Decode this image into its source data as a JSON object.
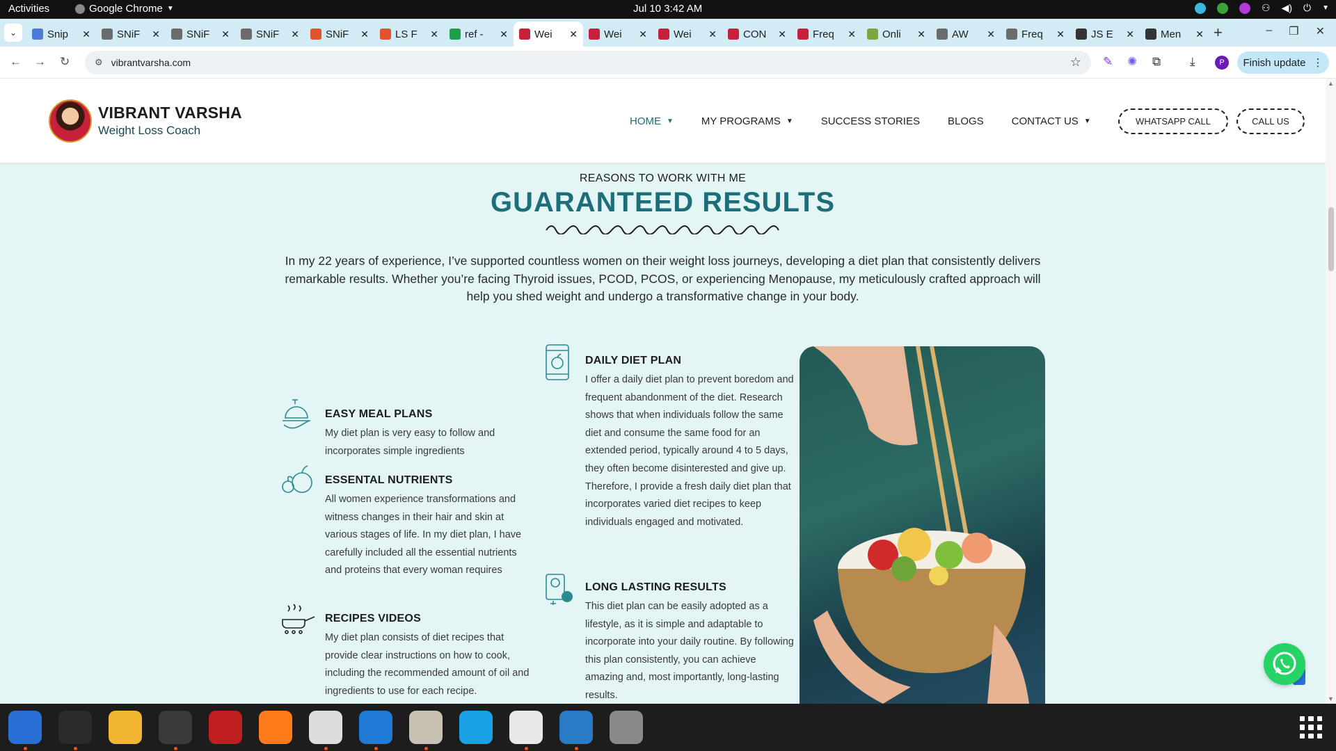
{
  "system": {
    "activities": "Activities",
    "app_name": "Google Chrome",
    "clock": "Jul 10  3:42 AM"
  },
  "browser": {
    "tabs": [
      {
        "label": "Snip",
        "color": "#4a7bd8"
      },
      {
        "label": "SNiF",
        "color": "#6b6b6b"
      },
      {
        "label": "SNiF",
        "color": "#6b6b6b"
      },
      {
        "label": "SNiF",
        "color": "#6b6b6b"
      },
      {
        "label": "SNiF",
        "color": "#e0542c"
      },
      {
        "label": "LS F",
        "color": "#e0542c"
      },
      {
        "label": "ref -",
        "color": "#1e9e4a"
      },
      {
        "label": "Wei",
        "color": "#c6203b"
      },
      {
        "label": "Wei",
        "color": "#c6203b"
      },
      {
        "label": "Wei",
        "color": "#c6203b"
      },
      {
        "label": "CON",
        "color": "#c6203b"
      },
      {
        "label": "Freq",
        "color": "#c6203b"
      },
      {
        "label": "Onli",
        "color": "#7aa83c"
      },
      {
        "label": "AW",
        "color": "#6b6b6b"
      },
      {
        "label": "Freq",
        "color": "#6b6b6b"
      },
      {
        "label": "JS E",
        "color": "#333333"
      },
      {
        "label": "Men",
        "color": "#333333"
      }
    ],
    "active_tab_index": 7,
    "url": "vibrantvarsha.com",
    "finish_update": "Finish update",
    "profile_initial": "P"
  },
  "site": {
    "brand": {
      "name": "VIBRANT VARSHA",
      "tagline": "Weight Loss Coach"
    },
    "nav": [
      {
        "label": "HOME",
        "has_caret": true,
        "active": true
      },
      {
        "label": "MY PROGRAMS",
        "has_caret": true,
        "active": false
      },
      {
        "label": "SUCCESS STORIES",
        "has_caret": false,
        "active": false
      },
      {
        "label": "BLOGS",
        "has_caret": false,
        "active": false
      },
      {
        "label": "CONTACT US",
        "has_caret": true,
        "active": false
      }
    ],
    "whatsapp_call": "WHATSAPP CALL",
    "call_us": "CALL US",
    "accent_color": "#1c6e78"
  },
  "section": {
    "eyebrow": "REASONS TO WORK WITH ME",
    "title": "GUARANTEED RESULTS",
    "intro": "In my 22 years of experience, I’ve supported countless women on their weight loss journeys, developing a diet plan that consistently delivers remarkable results. Whether you’re facing Thyroid issues, PCOD, PCOS, or experiencing Menopause, my meticulously crafted approach will help you shed weight and undergo a transformative change in your body.",
    "features": {
      "easy_meal": {
        "title": "EASY MEAL PLANS",
        "text": "My diet plan is very easy to follow and incorporates simple ingredients",
        "icon": "meal-cloche-icon"
      },
      "nutrients": {
        "title": "ESSENTAL NUTRIENTS",
        "text": "All women experience transformations and witness changes in their hair and skin at various stages of life. In my diet plan, I have carefully included all the essential nutrients and proteins that every woman requires",
        "icon": "fruits-icon"
      },
      "recipes": {
        "title": "RECIPES VIDEOS",
        "text": "My diet plan consists of diet recipes that provide clear instructions on how to cook, including the recommended amount of oil and ingredients to use for each recipe. Additionally, all of my",
        "icon": "cooking-pan-icon"
      },
      "daily": {
        "title": "DAILY DIET PLAN",
        "text": "I offer a daily diet plan to prevent boredom and frequent abandonment of the diet. Research shows that when individuals follow the same diet and consume the same food for an extended period, typically around 4 to 5 days, they often become disinterested and give up. Therefore, I provide a fresh daily diet plan that incorporates varied diet recipes to keep individuals engaged and motivated.",
        "icon": "phone-apple-icon"
      },
      "lasting": {
        "title": "LONG LASTING RESULTS",
        "text": "This diet plan can be easily adopted as a lifestyle, as it is simple and adaptable to incorporate into your daily routine. By following this plan consistently, you can achieve amazing and, most importantly, long-lasting results.",
        "icon": "scale-apple-icon"
      }
    }
  },
  "dock": [
    {
      "name": "thunderbird-icon",
      "color": "#2a6fd6"
    },
    {
      "name": "terminal-icon",
      "color": "#2b2b2b"
    },
    {
      "name": "notes-icon",
      "color": "#f2b632"
    },
    {
      "name": "system-monitor-icon",
      "color": "#3a3a3a"
    },
    {
      "name": "filezilla-icon",
      "color": "#bf1f1f"
    },
    {
      "name": "firefox-icon",
      "color": "#ff7a1a"
    },
    {
      "name": "chrome-icon",
      "color": "#dddddd"
    },
    {
      "name": "vscode-icon",
      "color": "#1f7bd6"
    },
    {
      "name": "files-icon",
      "color": "#c9c2b3"
    },
    {
      "name": "skype-icon",
      "color": "#1aa1e6"
    },
    {
      "name": "text-editor-icon",
      "color": "#e8e8e8"
    },
    {
      "name": "writer-icon",
      "color": "#2a7bc6"
    },
    {
      "name": "disk-icon",
      "color": "#8a8a8a"
    }
  ]
}
